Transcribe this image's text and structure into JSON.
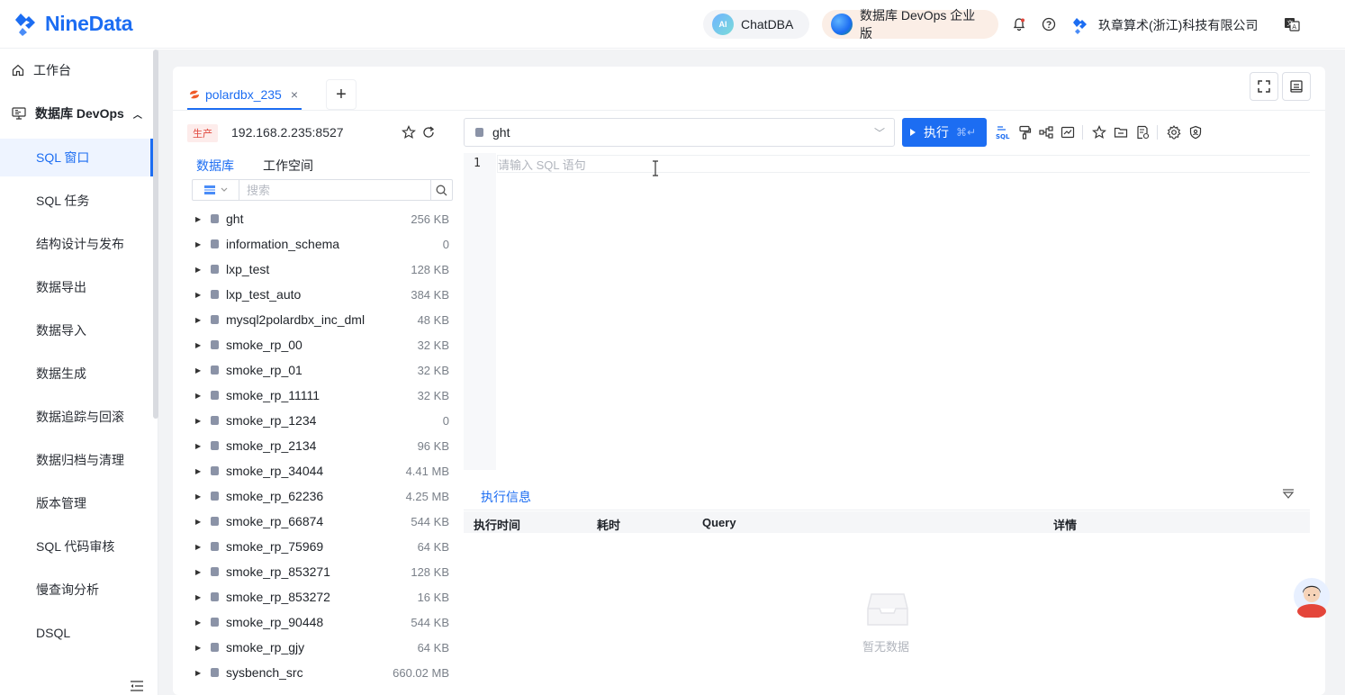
{
  "header": {
    "logo_text": "NineData",
    "chatdba": {
      "label": "ChatDBA",
      "badge": "AI"
    },
    "devops": {
      "label": "数据库 DevOps 企业版"
    },
    "company": "玖章算术(浙江)科技有限公司",
    "icons": [
      "bell-icon",
      "help-icon",
      "language-icon"
    ]
  },
  "sidebar": {
    "workbench": "工作台",
    "devops_section": "数据库 DevOps",
    "items": [
      {
        "label": "SQL 窗口",
        "active": true
      },
      {
        "label": "SQL 任务"
      },
      {
        "label": "结构设计与发布"
      },
      {
        "label": "数据导出"
      },
      {
        "label": "数据导入"
      },
      {
        "label": "数据生成"
      },
      {
        "label": "数据追踪与回滚"
      },
      {
        "label": "数据归档与清理"
      },
      {
        "label": "版本管理"
      },
      {
        "label": "SQL 代码审核"
      },
      {
        "label": "慢查询分析"
      },
      {
        "label": "DSQL"
      }
    ]
  },
  "tabs": [
    {
      "label": "polardbx_235",
      "close": "×"
    }
  ],
  "add_tab": "+",
  "connection": {
    "env": "生产",
    "host": "192.168.2.235:8527"
  },
  "left_tabs": {
    "databases": "数据库",
    "workspace": "工作空间"
  },
  "search": {
    "placeholder": "搜索"
  },
  "databases": [
    {
      "name": "ght",
      "size": "256 KB"
    },
    {
      "name": "information_schema",
      "size": "0"
    },
    {
      "name": "lxp_test",
      "size": "128 KB"
    },
    {
      "name": "lxp_test_auto",
      "size": "384 KB"
    },
    {
      "name": "mysql2polardbx_inc_dml",
      "size": "48 KB"
    },
    {
      "name": "smoke_rp_00",
      "size": "32 KB"
    },
    {
      "name": "smoke_rp_01",
      "size": "32 KB"
    },
    {
      "name": "smoke_rp_11111",
      "size": "32 KB"
    },
    {
      "name": "smoke_rp_1234",
      "size": "0"
    },
    {
      "name": "smoke_rp_2134",
      "size": "96 KB"
    },
    {
      "name": "smoke_rp_34044",
      "size": "4.41 MB"
    },
    {
      "name": "smoke_rp_62236",
      "size": "4.25 MB"
    },
    {
      "name": "smoke_rp_66874",
      "size": "544 KB"
    },
    {
      "name": "smoke_rp_75969",
      "size": "64 KB"
    },
    {
      "name": "smoke_rp_853271",
      "size": "128 KB"
    },
    {
      "name": "smoke_rp_853272",
      "size": "16 KB"
    },
    {
      "name": "smoke_rp_90448",
      "size": "544 KB"
    },
    {
      "name": "smoke_rp_gjy",
      "size": "64 KB"
    },
    {
      "name": "sysbench_src",
      "size": "660.02 MB"
    }
  ],
  "editor": {
    "current_db": "ght",
    "run_label": "执行",
    "run_shortcut": "⌘↵",
    "line_number": "1",
    "placeholder": "请输入 SQL 语句"
  },
  "exec_panel": {
    "tab": "执行信息",
    "columns": [
      "执行时间",
      "耗时",
      "Query",
      "详情"
    ],
    "empty": "暂无数据"
  },
  "colors": {
    "primary": "#1c6df2",
    "env_badge": "#e0473c"
  }
}
